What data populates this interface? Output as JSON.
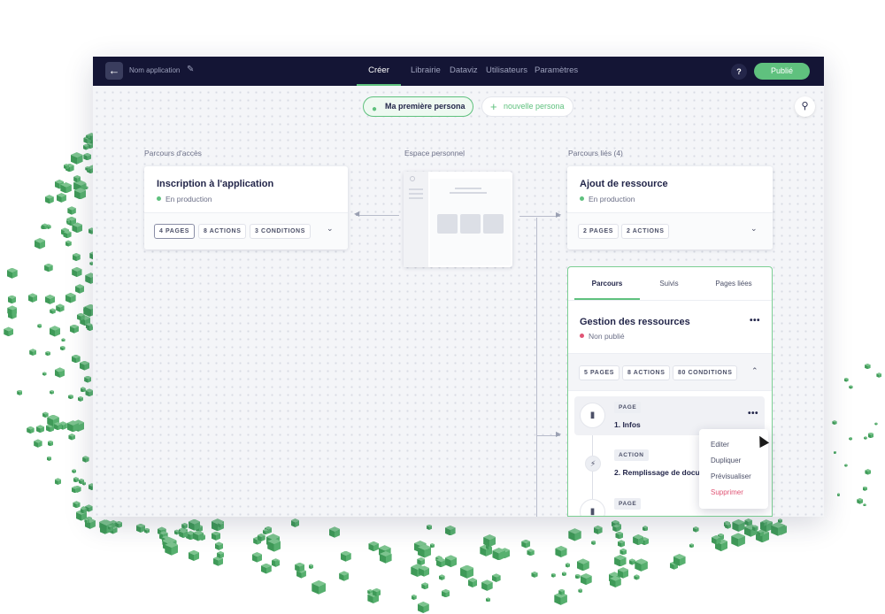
{
  "topbar": {
    "back_icon": "arrow-left-icon",
    "app_name": "Nom application",
    "edit_icon": "pencil-icon",
    "nav": [
      "Créer",
      "Librairie",
      "Dataviz",
      "Utilisateurs",
      "Paramètres"
    ],
    "active_nav": "Créer",
    "help_label": "?",
    "publish_label": "Publié",
    "accent": "#5fc17e",
    "bar_color": "#141535"
  },
  "personas": {
    "active_label": "Ma première persona",
    "new_label": "nouvelle persona",
    "active_icon": "user-icon",
    "new_icon": "plus-icon",
    "search_icon": "search-icon"
  },
  "sections": {
    "access": "Parcours d'accès",
    "personal": "Espace personnel",
    "linked": "Parcours liés (4)"
  },
  "access_card": {
    "title": "Inscription à l'application",
    "status": "En production",
    "status_color": "#5fc17e",
    "chips": [
      "4 PAGES",
      "8 ACTIONS",
      "3 CONDITIONS"
    ]
  },
  "linked_card": {
    "title": "Ajout de ressource",
    "status": "En production",
    "status_color": "#5fc17e",
    "chips": [
      "2 PAGES",
      "2 ACTIONS"
    ]
  },
  "detail_card": {
    "tabs": [
      "Parcours",
      "Suivis",
      "Pages liées"
    ],
    "active_tab": "Parcours",
    "title": "Gestion des ressources",
    "status": "Non publié",
    "status_color": "#e05575",
    "chips": [
      "5 PAGES",
      "8 ACTIONS",
      "80 CONDITIONS"
    ],
    "steps": [
      {
        "tag": "PAGE",
        "name": "1. Infos",
        "icon": "document-icon"
      },
      {
        "tag": "ACTION",
        "name": "2. Remplissage de docu",
        "icon": "lightning-icon"
      },
      {
        "tag": "PAGE",
        "name": "",
        "icon": "document-icon"
      }
    ]
  },
  "context_menu": {
    "items": [
      "Editer",
      "Dupliquer",
      "Prévisualiser",
      "Supprimer"
    ],
    "danger_color": "#e05575"
  }
}
